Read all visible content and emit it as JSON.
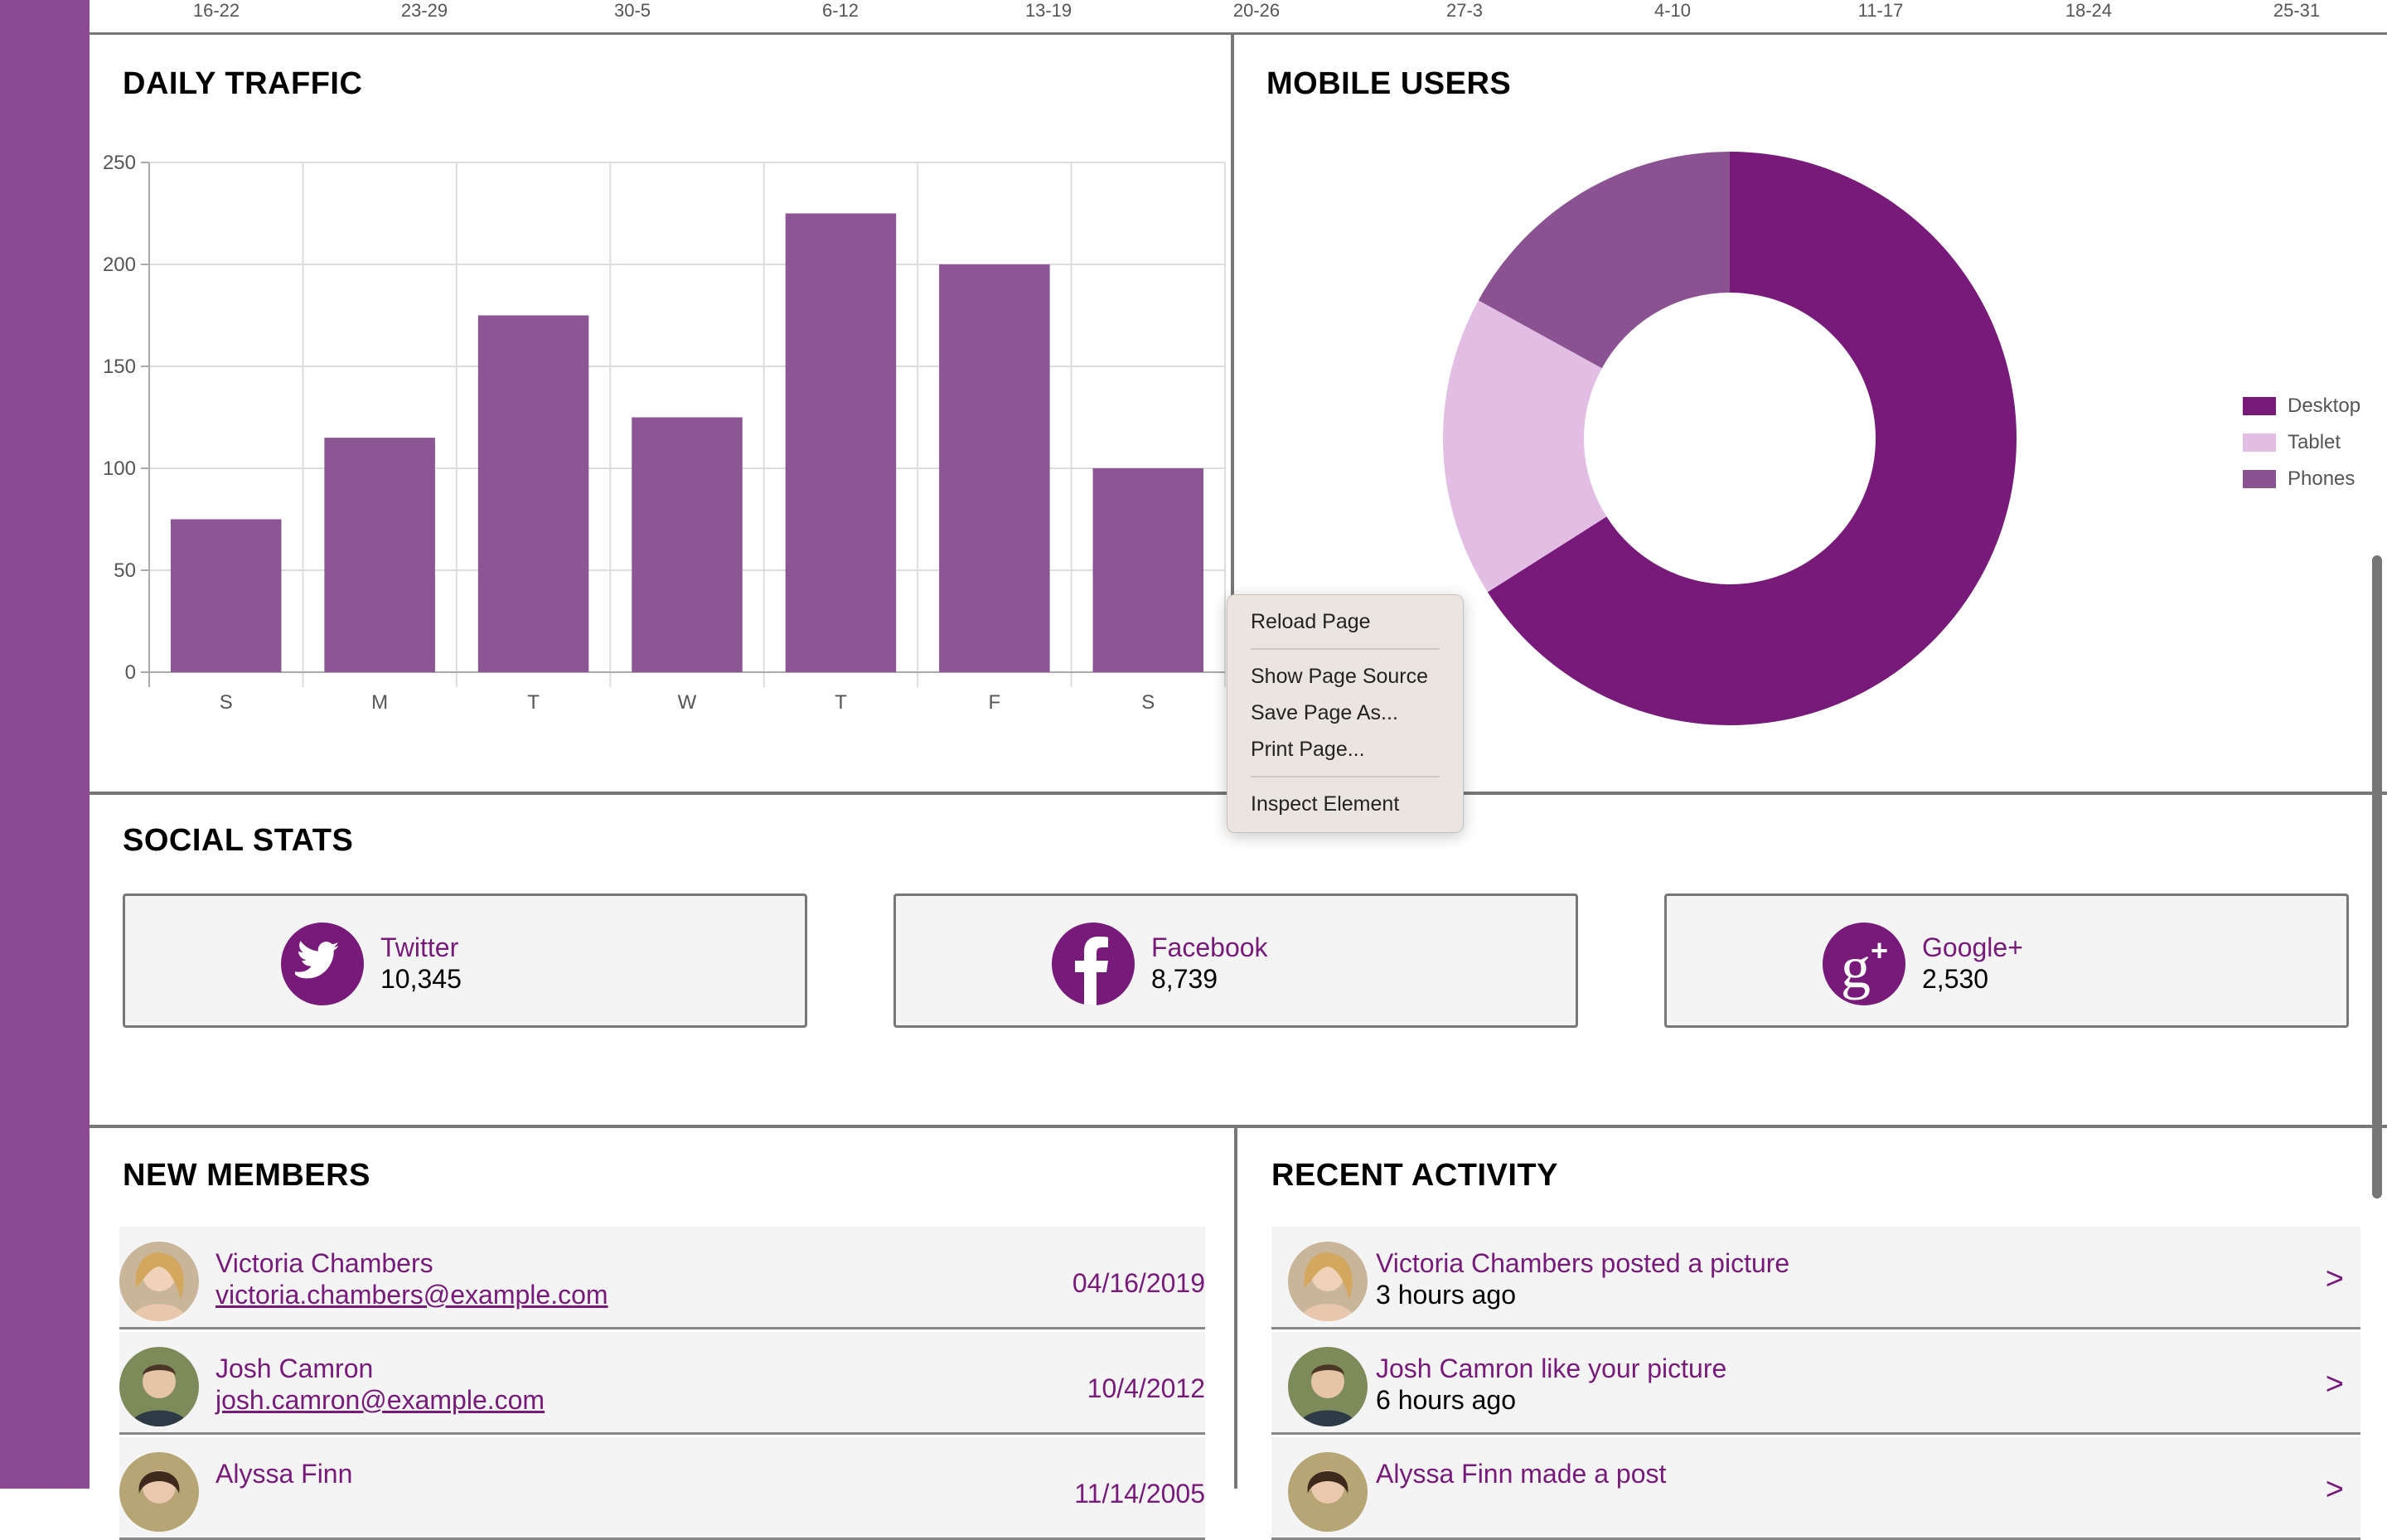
{
  "top_axis": {
    "ticks": [
      "16-22",
      "23-29",
      "30-5",
      "6-12",
      "13-19",
      "20-26",
      "27-3",
      "4-10",
      "11-17",
      "18-24",
      "25-31"
    ]
  },
  "daily_traffic": {
    "title": "DAILY TRAFFIC"
  },
  "mobile_users": {
    "title": "MOBILE USERS"
  },
  "social_stats": {
    "title": "SOCIAL STATS",
    "cards": [
      {
        "name": "Twitter",
        "count": "10,345",
        "icon": "twitter-icon"
      },
      {
        "name": "Facebook",
        "count": "8,739",
        "icon": "facebook-icon"
      },
      {
        "name": "Google+",
        "count": "2,530",
        "icon": "google-plus-icon"
      }
    ]
  },
  "new_members": {
    "title": "NEW MEMBERS",
    "rows": [
      {
        "name": "Victoria Chambers",
        "email": "victoria.chambers@example.com",
        "date": "04/16/2019"
      },
      {
        "name": "Josh Camron",
        "email": "josh.camron@example.com",
        "date": "10/4/2012"
      },
      {
        "name": "Alyssa Finn",
        "email": "",
        "date": "11/14/2005"
      }
    ]
  },
  "recent_activity": {
    "title": "RECENT ACTIVITY",
    "rows": [
      {
        "text": "Victoria Chambers posted a picture",
        "time": "3 hours ago",
        "arrow": ">"
      },
      {
        "text": "Josh Camron like your picture",
        "time": "6 hours ago",
        "arrow": ">"
      },
      {
        "text": "Alyssa Finn made a post",
        "time": "",
        "arrow": ">"
      }
    ]
  },
  "context_menu": {
    "items": [
      "Reload Page",
      "Show Page Source",
      "Save Page As...",
      "Print Page...",
      "Inspect Element"
    ]
  },
  "colors": {
    "accent": "#771a7a",
    "bar": "#8c5594",
    "tablet": "#e2bde4",
    "phones": "#8b5292",
    "sidebar": "#8c4a94"
  },
  "chart_data": [
    {
      "type": "bar",
      "title": "DAILY TRAFFIC",
      "categories": [
        "S",
        "M",
        "T",
        "W",
        "T",
        "F",
        "S"
      ],
      "values": [
        75,
        115,
        175,
        125,
        225,
        200,
        100
      ],
      "yticks": [
        0,
        50,
        100,
        150,
        200,
        250
      ],
      "ylim": [
        0,
        250
      ],
      "grid": true,
      "xlabel": "",
      "ylabel": ""
    },
    {
      "type": "pie",
      "title": "MOBILE USERS",
      "donut": true,
      "labels": [
        "Desktop",
        "Tablet",
        "Phones"
      ],
      "values": [
        66,
        17,
        17
      ],
      "colors": [
        "#771a7a",
        "#e2bde4",
        "#8b5292"
      ],
      "legend": "right"
    }
  ]
}
